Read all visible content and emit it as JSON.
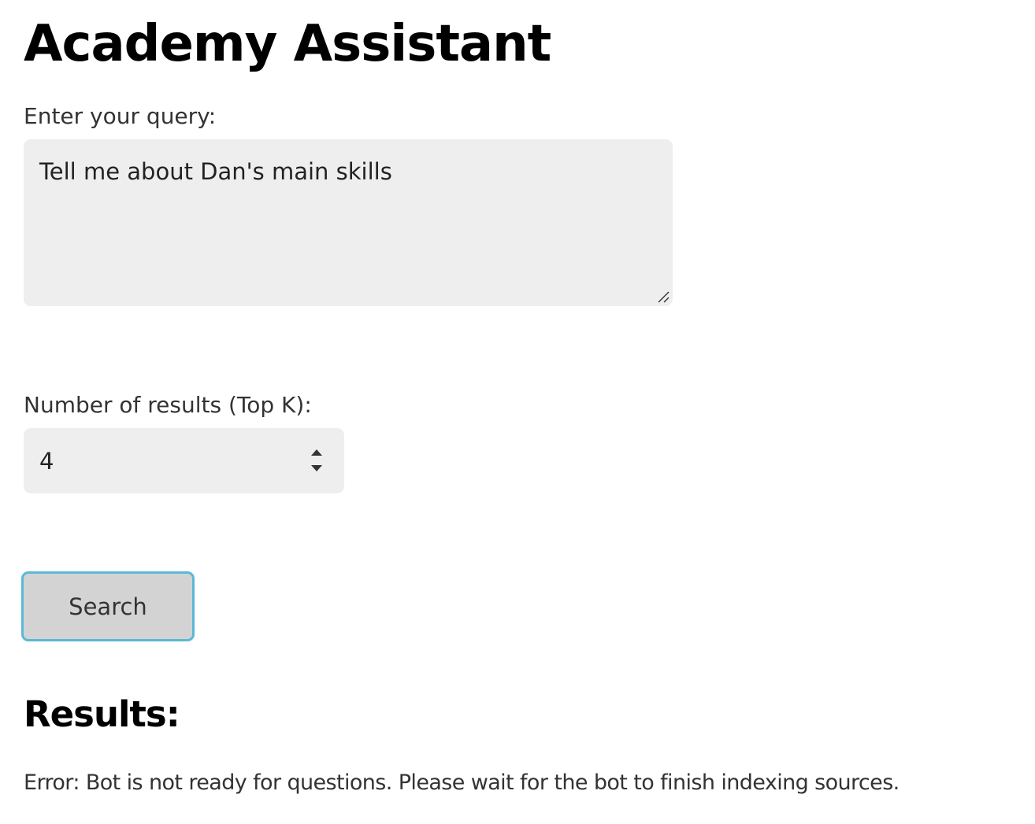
{
  "app": {
    "title": "Academy Assistant"
  },
  "query": {
    "label": "Enter your query:",
    "value": "Tell me about Dan's main skills"
  },
  "top_k": {
    "label": "Number of results (Top K):",
    "value": "4"
  },
  "actions": {
    "search_label": "Search"
  },
  "results": {
    "heading": "Results:",
    "message": "Error: Bot is not ready for questions. Please wait for the bot to finish indexing sources."
  },
  "icons": {
    "resize": "resize-handle-icon",
    "spin_up": "chevron-up-icon",
    "spin_down": "chevron-down-icon"
  },
  "colors": {
    "input_background": "#eeeeee",
    "button_background": "#d3d3d3",
    "button_focus_border": "#5bb8d6",
    "text": "#333333",
    "heading": "#000000"
  }
}
